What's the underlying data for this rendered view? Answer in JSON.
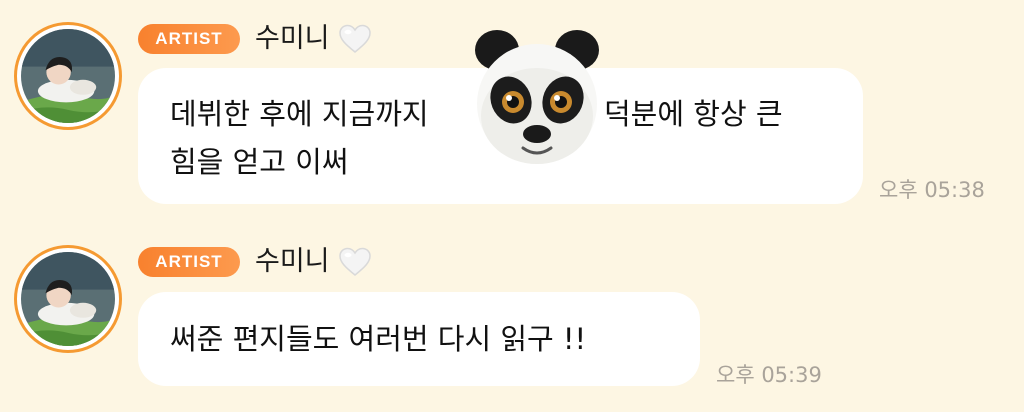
{
  "messages": [
    {
      "badge": "ARTIST",
      "name": "수미니",
      "lines": [
        "데뷔한 후에 지금까지",
        "덕분에 항상 큰",
        "힘을 얻고 이써"
      ],
      "time": "오후 05:38"
    },
    {
      "badge": "ARTIST",
      "name": "수미니",
      "lines": [
        "써준 편지들도 여러번 다시 읽구 !!"
      ],
      "time": "오후 05:39"
    }
  ],
  "icons": {
    "avatar": "profile-photo",
    "heart": "white-heart-icon",
    "sticker": "panda-emoji-sticker"
  },
  "colors": {
    "background": "#fdf6e3",
    "badge": "#f8812e",
    "avatar_ring": "#f59a32",
    "bubble": "#ffffff",
    "timestamp": "#a9a39a"
  }
}
